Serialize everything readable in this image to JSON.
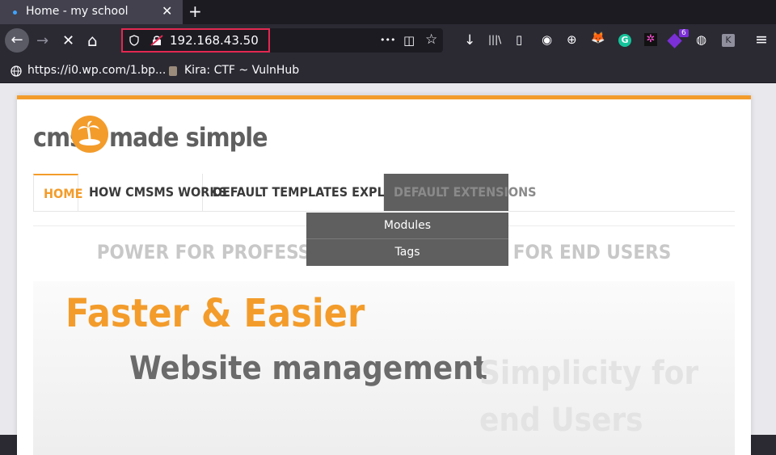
{
  "tab": {
    "title": "Home - my school",
    "close": "✕",
    "new_tab": "+"
  },
  "toolbar": {
    "back": "←",
    "forward": "→",
    "stop": "✕",
    "home": "⌂",
    "url": "192.168.43.50",
    "more": "•••",
    "pocket": "◫",
    "star": "☆",
    "download": "↓",
    "library": "|||\\",
    "sidebar": "▯",
    "account": "◉",
    "ext_globe": "⊕",
    "ext_fox": "🦊",
    "ext_grammarly": "G",
    "ext_star": "✲",
    "ext_badge_count": "6",
    "ext_cookie": "◍",
    "ext_k": "K",
    "menu": "≡"
  },
  "bookmarks": [
    {
      "label": "https://i0.wp.com/1.bp...",
      "icon": "globe-icon"
    },
    {
      "label": "Kira: CTF ~ VulnHub",
      "icon": "page-icon"
    }
  ],
  "site": {
    "logo_left": "cms",
    "logo_right": "made simple",
    "nav": [
      "HOME",
      "HOW CMSMS WORKS",
      "DEFAULT TEMPLATES EXPLAINED",
      "DEFAULT EXTENSIONS"
    ],
    "dropdown": [
      "Modules",
      "Tags"
    ],
    "tagline": "POWER FOR PROFESSIONALS, SIMPLICITY FOR END USERS",
    "banner_heading": "Faster & Easier",
    "banner_left": "Website management",
    "banner_right": "Simplicity for end Users"
  },
  "colors": {
    "accent": "#f39c2b",
    "url_highlight": "#e22850"
  }
}
